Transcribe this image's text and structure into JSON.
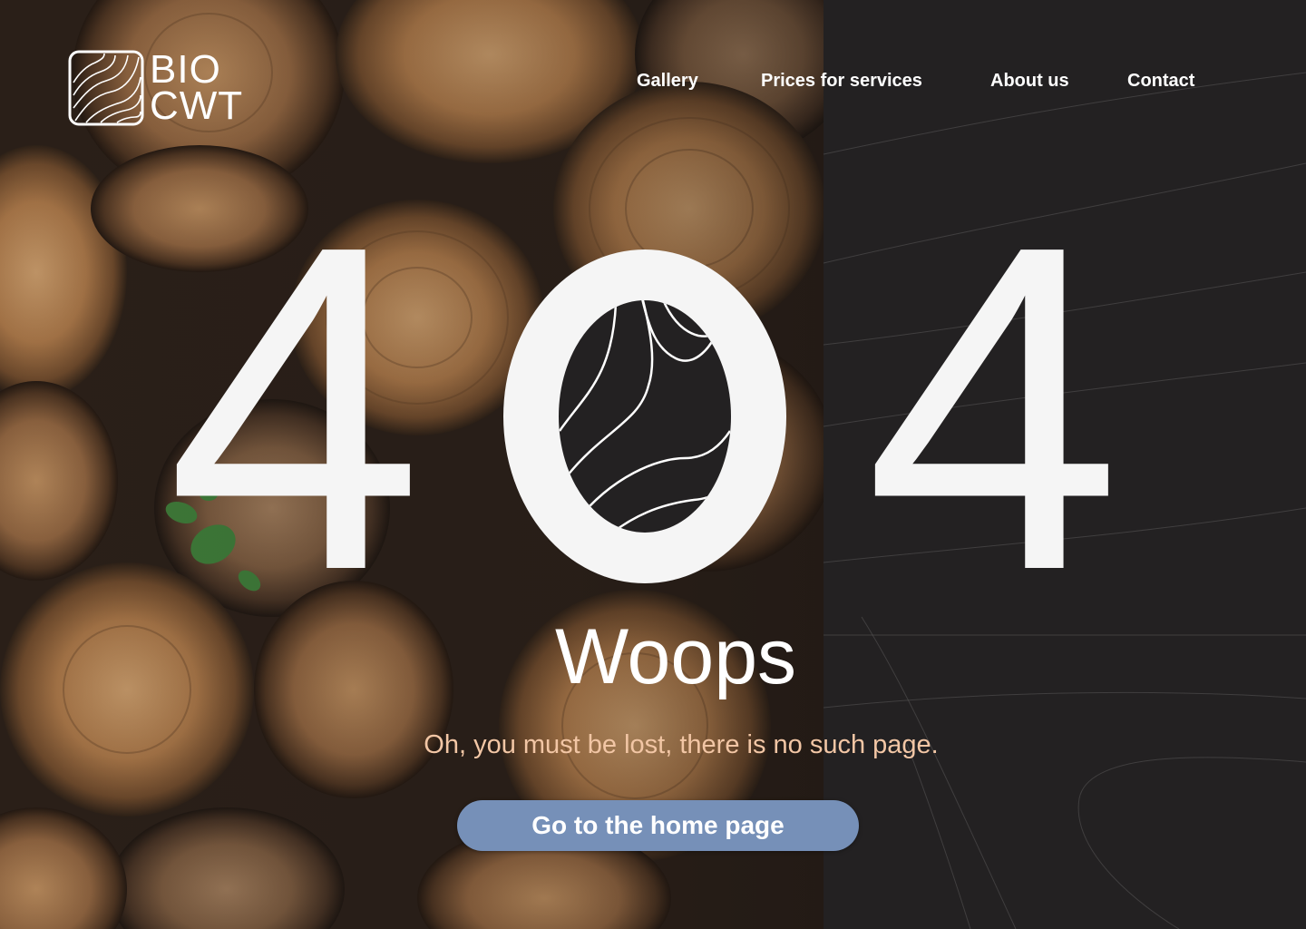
{
  "brand": {
    "logo_line1": "BIO",
    "logo_line2": "CWT"
  },
  "nav": {
    "items": [
      {
        "label": "Gallery"
      },
      {
        "label": "Prices for services"
      },
      {
        "label": "About us"
      },
      {
        "label": "Contact"
      }
    ]
  },
  "error": {
    "code_left": "4",
    "code_middle": "0",
    "code_right": "4",
    "title": "Woops",
    "message": "Oh, you must be lost, there is no such page.",
    "cta_label": "Go to the home page"
  },
  "colors": {
    "background": "#232122",
    "text": "#f5f5f5",
    "subtitle": "#f2c6a5",
    "button": "#7690b8"
  }
}
